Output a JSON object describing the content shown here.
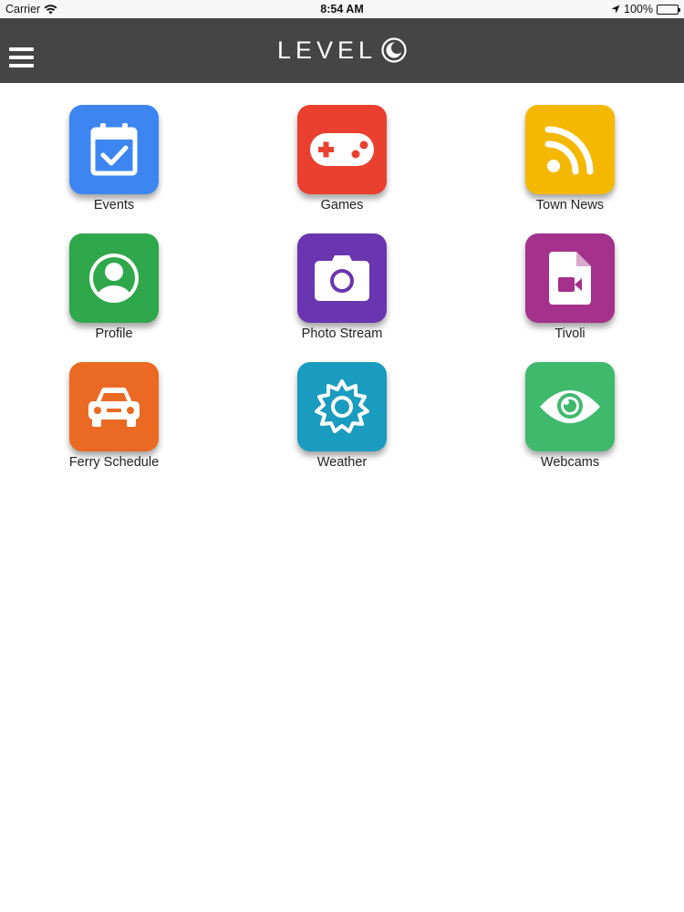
{
  "status_bar": {
    "carrier": "Carrier",
    "time": "8:54 AM",
    "battery": "100%",
    "icons": [
      "wifi-icon",
      "location-arrow-icon",
      "battery-icon"
    ]
  },
  "header": {
    "logo_text": "LEVEL",
    "logo_icon": "level-moon-icon",
    "menu_icon": "hamburger-menu-icon",
    "background": "#454545"
  },
  "tiles": [
    {
      "label": "Events",
      "icon": "calendar-check-icon",
      "color": "#3d86f2"
    },
    {
      "label": "Games",
      "icon": "gamepad-icon",
      "color": "#e9402f"
    },
    {
      "label": "Town News",
      "icon": "rss-feed-icon",
      "color": "#f5b800"
    },
    {
      "label": "Profile",
      "icon": "user-profile-icon",
      "color": "#2fa84b"
    },
    {
      "label": "Photo Stream",
      "icon": "camera-icon",
      "color": "#6a35b0"
    },
    {
      "label": "Tivoli",
      "icon": "video-file-icon",
      "color": "#a4318b"
    },
    {
      "label": "Ferry Schedule",
      "icon": "car-icon",
      "color": "#eb6a23"
    },
    {
      "label": "Weather",
      "icon": "sun-gear-icon",
      "color": "#199cbf"
    },
    {
      "label": "Webcams",
      "icon": "eye-icon",
      "color": "#3fba6c"
    }
  ]
}
